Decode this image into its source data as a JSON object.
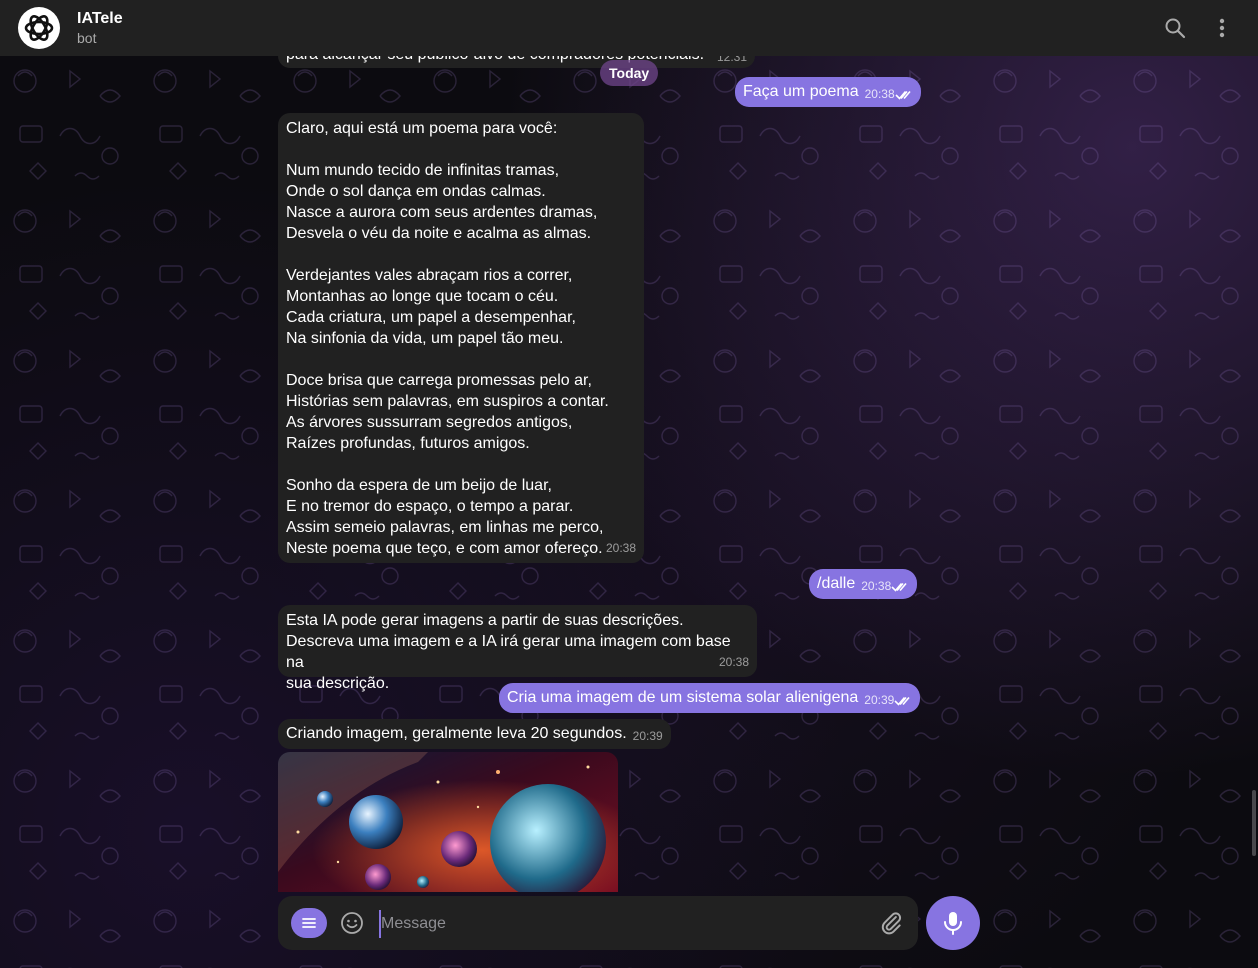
{
  "header": {
    "title": "IATele",
    "subtitle": "bot",
    "avatar_icon": "openai-logo-icon"
  },
  "date_separator": "Today",
  "messages": [
    {
      "id": "m0",
      "direction": "in",
      "text": "para alcançar seu público-alvo de compradores potenciais.",
      "time": "12:31"
    },
    {
      "id": "m1",
      "direction": "out",
      "text": "Faça um poema",
      "time": "20:38",
      "status": "read"
    },
    {
      "id": "m2",
      "direction": "in",
      "text": "Claro, aqui está um poema para você:\n\nNum mundo tecido de infinitas tramas,\nOnde o sol dança em ondas calmas.\nNasce a aurora com seus ardentes dramas,\nDesvela o véu da noite e acalma as almas.\n\nVerdejantes vales abraçam rios a correr,\nMontanhas ao longe que tocam o céu.\nCada criatura, um papel a desempenhar,\nNa sinfonia da vida, um papel tão meu.\n\nDoce brisa que carrega promessas pelo ar,\nHistórias sem palavras, em suspiros a contar.\nAs árvores sussurram segredos antigos,\nRaízes profundas, futuros amigos.\n\nSonho da espera de um beijo de luar,\nE no tremor do espaço, o tempo a parar.\nAssim semeio palavras, em linhas me perco,\nNeste poema que teço, e com amor ofereço.",
      "time": "20:38"
    },
    {
      "id": "m3",
      "direction": "out",
      "text": "/dalle",
      "time": "20:38",
      "status": "read"
    },
    {
      "id": "m4",
      "direction": "in",
      "text": "Esta IA pode gerar imagens a partir de suas descrições.\nDescreva uma imagem e a IA irá gerar uma imagem com base na\nsua descrição.",
      "time": "20:38"
    },
    {
      "id": "m5",
      "direction": "out",
      "text": "Cria uma imagem de um sistema solar alienigena",
      "time": "20:39",
      "status": "read"
    },
    {
      "id": "m6",
      "direction": "in",
      "text": "Criando imagem, geralmente leva 20 segundos.",
      "time": "20:39"
    }
  ],
  "composer": {
    "placeholder": "Message"
  },
  "colors": {
    "accent": "#8774e1",
    "incoming_bubble": "#212121",
    "header": "#212121"
  }
}
